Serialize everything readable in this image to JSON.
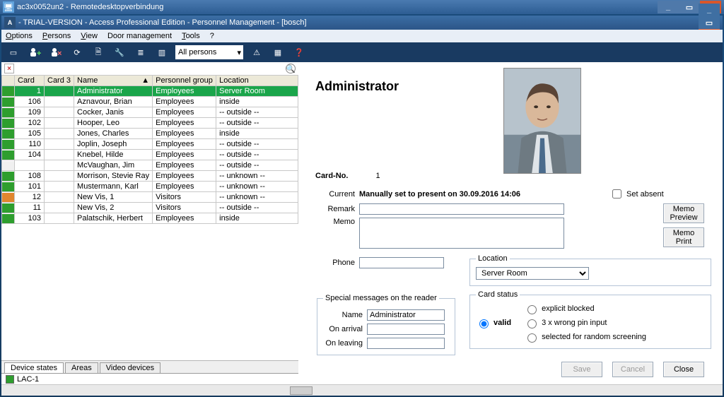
{
  "rdp": {
    "title": "ac3x0052un2 - Remotedesktopverbindung"
  },
  "app": {
    "title": "- TRIAL-VERSION - Access Professional Edition - Personnel Management - [bosch]"
  },
  "menus": {
    "options": "Options",
    "persons": "Persons",
    "view": "View",
    "door": "Door management",
    "tools": "Tools",
    "help": "?"
  },
  "toolbar": {
    "combo": "All persons"
  },
  "columns": {
    "state": "",
    "card": "Card",
    "card3": "Card 3",
    "name": "Name",
    "group": "Personnel group",
    "location": "Location"
  },
  "rows": [
    {
      "state": "s-green",
      "card": "1",
      "card3": "",
      "name": "Administrator",
      "group": "Employees",
      "loc": "Server Room",
      "sel": true
    },
    {
      "state": "s-green",
      "card": "106",
      "card3": "",
      "name": "Aznavour, Brian",
      "group": "Employees",
      "loc": "inside"
    },
    {
      "state": "s-green",
      "card": "109",
      "card3": "",
      "name": "Cocker, Janis",
      "group": "Employees",
      "loc": "-- outside --"
    },
    {
      "state": "s-green",
      "card": "102",
      "card3": "",
      "name": "Hooper, Leo",
      "group": "Employees",
      "loc": "-- outside --"
    },
    {
      "state": "s-green",
      "card": "105",
      "card3": "",
      "name": "Jones, Charles",
      "group": "Employees",
      "loc": "inside"
    },
    {
      "state": "s-green",
      "card": "110",
      "card3": "",
      "name": "Joplin, Joseph",
      "group": "Employees",
      "loc": "-- outside --"
    },
    {
      "state": "s-green",
      "card": "104",
      "card3": "",
      "name": "Knebel, Hilde",
      "group": "Employees",
      "loc": "-- outside --"
    },
    {
      "state": "s-none",
      "card": "",
      "card3": "",
      "name": "McVaughan, Jim",
      "group": "Employees",
      "loc": "-- outside --"
    },
    {
      "state": "s-green",
      "card": "108",
      "card3": "",
      "name": "Morrison, Stevie Ray",
      "group": "Employees",
      "loc": "-- unknown --"
    },
    {
      "state": "s-green",
      "card": "101",
      "card3": "",
      "name": "Mustermann, Karl",
      "group": "Employees",
      "loc": "-- unknown --"
    },
    {
      "state": "s-orange",
      "card": "12",
      "card3": "",
      "name": "New Vis, 1",
      "group": "Visitors",
      "loc": "-- unknown --"
    },
    {
      "state": "s-green",
      "card": "11",
      "card3": "",
      "name": "New Vis, 2",
      "group": "Visitors",
      "loc": "-- outside --"
    },
    {
      "state": "s-green",
      "card": "103",
      "card3": "",
      "name": "Palatschik, Herbert",
      "group": "Employees",
      "loc": "inside"
    }
  ],
  "detail": {
    "heading": "Administrator",
    "card_no_label": "Card-No.",
    "card_no": "1",
    "current_label": "Current",
    "current": "Manually set to present on 30.09.2016 14:06",
    "set_absent": "Set absent",
    "remark_label": "Remark",
    "memo_label": "Memo",
    "phone_label": "Phone",
    "location_label": "Location",
    "location_value": "Server Room",
    "card_status_label": "Card status",
    "status_valid": "valid",
    "status_blocked": "explicit blocked",
    "status_wrong_pin": "3 x wrong pin input",
    "status_random": "selected for random screening",
    "reader_legend": "Special messages on the reader",
    "name_label": "Name",
    "name_value": "Administrator",
    "on_arrival_label": "On arrival",
    "on_leaving_label": "On leaving",
    "btn_memo_preview": "Memo Preview",
    "btn_memo_print": "Memo Print",
    "btn_save": "Save",
    "btn_cancel": "Cancel",
    "btn_close": "Close"
  },
  "bottom": {
    "tab1": "Device states",
    "tab2": "Areas",
    "tab3": "Video devices",
    "device": "LAC-1"
  }
}
